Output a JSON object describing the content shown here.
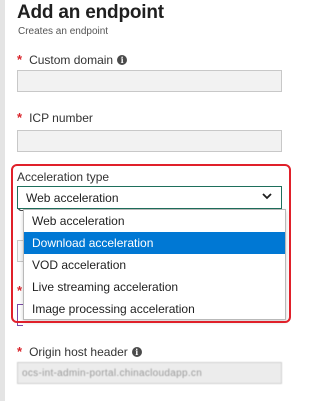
{
  "header": {
    "title": "Add an endpoint",
    "subtitle": "Creates an endpoint"
  },
  "fields": {
    "custom_domain": {
      "required_mark": "*",
      "label": "Custom domain",
      "value": ""
    },
    "icp_number": {
      "required_mark": "*",
      "label": "ICP number",
      "value": ""
    },
    "acceleration_type": {
      "label": "Acceleration type",
      "selected_value": "Web acceleration",
      "options": [
        "Web acceleration",
        "Download acceleration",
        "VOD acceleration",
        "Live streaming acceleration",
        "Image processing acceleration"
      ],
      "highlighted_option": "Download acceleration",
      "highlight_color": "#e0202a",
      "option_hover_color": "#0078d4"
    },
    "origin_host_header": {
      "required_mark": "*",
      "label": "Origin host header",
      "value": "ocs-int-admin-portal.chinacloudapp.cn"
    }
  },
  "obscured": {
    "field_label_initial": "O",
    "required_mark": "*"
  },
  "icons": {
    "info": "info-icon",
    "dropdown": "chevron-down-icon"
  }
}
